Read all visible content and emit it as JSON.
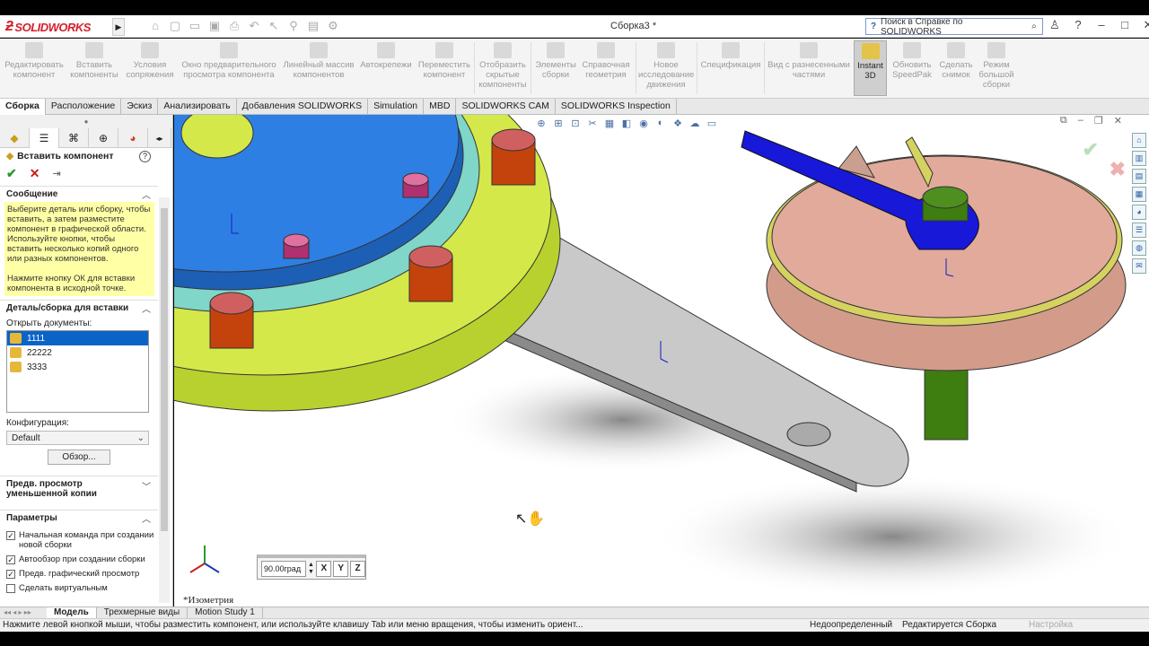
{
  "app": {
    "logo_text": "SOLIDWORKS",
    "document_title": "Сборка3 *",
    "search_placeholder": "Поиск в Справке по SOLIDWORKS"
  },
  "ribbon": {
    "buttons": [
      {
        "label": "Редактировать компонент"
      },
      {
        "label": "Вставить компоненты"
      },
      {
        "label": "Условия сопряжения"
      },
      {
        "label": "Окно предварительного просмотра компонента"
      },
      {
        "label": "Линейный массив компонентов"
      },
      {
        "label": "Автокрепежи"
      },
      {
        "label": "Переместить компонент"
      },
      {
        "label": "Отобразить скрытые компоненты"
      },
      {
        "label": "Элементы сборки"
      },
      {
        "label": "Справочная геометрия"
      },
      {
        "label": "Новое исследование движения"
      },
      {
        "label": "Спецификация"
      },
      {
        "label": "Вид с разнесенными частями"
      },
      {
        "label": "Instant 3D"
      },
      {
        "label": "Обновить SpeedPak"
      },
      {
        "label": "Сделать снимок"
      },
      {
        "label": "Режим большой сборки"
      }
    ]
  },
  "tabs": [
    "Сборка",
    "Расположение",
    "Эскиз",
    "Анализировать",
    "Добавления SOLIDWORKS",
    "Simulation",
    "MBD",
    "SOLIDWORKS CAM",
    "SOLIDWORKS Inspection"
  ],
  "property_manager": {
    "title": "Вставить компонент",
    "message_header": "Сообщение",
    "message": "Выберите деталь или сборку, чтобы вставить, а затем разместите компонент в графической области. Используйте кнопки, чтобы вставить несколько копий одного или разных компонентов.",
    "message2": "Нажмите кнопку ОК для вставки компонента в исходной точке.",
    "part_header": "Деталь/сборка для вставки",
    "open_docs_label": "Открыть документы:",
    "documents": [
      "1111",
      "22222",
      "3333"
    ],
    "config_label": "Конфигурация:",
    "config_value": "Default",
    "browse_label": "Обзор...",
    "thumb_header": "Предв. просмотр уменьшенной копии",
    "params_header": "Параметры",
    "options": [
      {
        "label": "Начальная команда при создании новой сборки",
        "checked": true
      },
      {
        "label": "Автообзор при создании сборки",
        "checked": true
      },
      {
        "label": "Предв. графический просмотр",
        "checked": true
      },
      {
        "label": "Сделать виртуальным",
        "checked": false
      }
    ]
  },
  "viewport": {
    "rotation_value": "90.00град",
    "view_name": "*Изометрия"
  },
  "bottom_tabs": [
    "Модель",
    "Трехмерные виды",
    "Motion Study 1"
  ],
  "status": {
    "message": "Нажмите левой кнопкой мыши, чтобы разместить компонент, или используйте клавишу Tab или меню вращения, чтобы изменить ориент...",
    "definition": "Недоопределенный",
    "editing": "Редактируется Сборка",
    "settings": "Настройка"
  }
}
